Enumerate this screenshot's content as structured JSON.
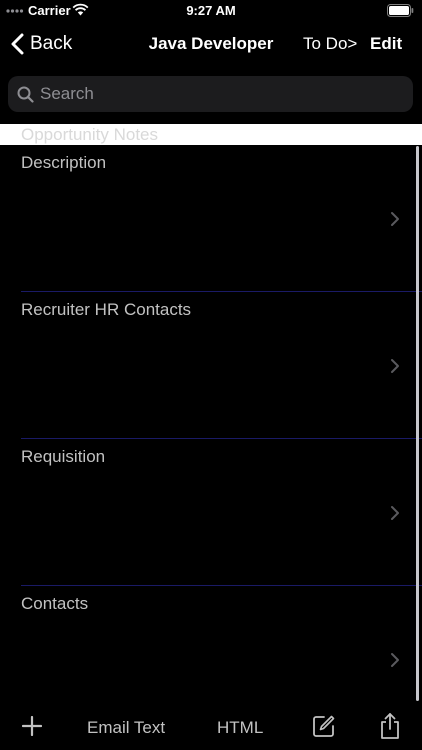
{
  "status_bar": {
    "carrier": "Carrier",
    "time": "9:27 AM"
  },
  "nav": {
    "back_label": "Back",
    "title": "Java Developer",
    "todo_label": "To Do>",
    "edit_label": "Edit"
  },
  "search": {
    "placeholder": "Search",
    "value": ""
  },
  "section": {
    "header": "Opportunity Notes"
  },
  "rows": [
    {
      "label": "Description"
    },
    {
      "label": "Recruiter HR Contacts"
    },
    {
      "label": "Requisition"
    },
    {
      "label": "Contacts"
    }
  ],
  "toolbar": {
    "email_text_label": "Email Text",
    "html_label": "HTML"
  },
  "colors": {
    "background": "#000000",
    "search_field": "#1c1c1e",
    "section_header_bg": "#ffffff",
    "separator": "#1a1a66",
    "muted_text": "#c2c2c2"
  },
  "icons": [
    "signal-dots-icon",
    "wifi-icon",
    "battery-icon",
    "chevron-left-icon",
    "search-icon",
    "chevron-right-icon",
    "plus-icon",
    "compose-icon",
    "share-icon"
  ]
}
